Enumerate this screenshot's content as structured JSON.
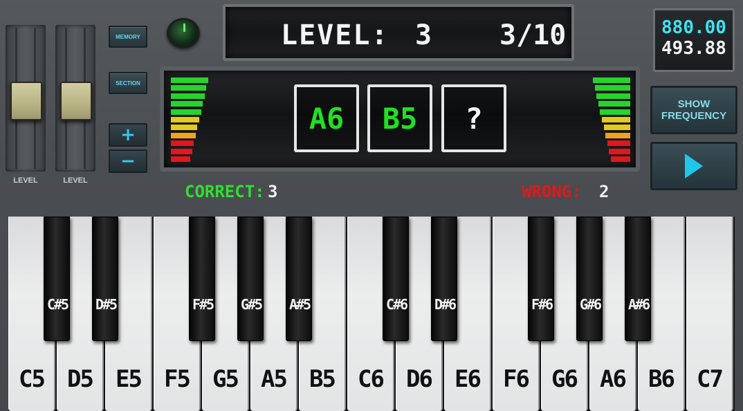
{
  "sliders": [
    {
      "label": "LEVEL"
    },
    {
      "label": "LEVEL"
    }
  ],
  "buttons": {
    "memory": "MEMORY",
    "section": "SECTION",
    "plus": "+",
    "minus": "−",
    "show_frequency": "SHOW FREQUENCY"
  },
  "level": {
    "label": "LEVEL:",
    "value": "3",
    "progress": "3/10"
  },
  "frequency": {
    "target": "880.00",
    "current": "493.88"
  },
  "notes": [
    {
      "text": "A6",
      "color": "#22e022"
    },
    {
      "text": "B5",
      "color": "#22e022"
    },
    {
      "text": "?",
      "color": "#f4f4f4"
    }
  ],
  "score": {
    "correct_label": "CORRECT:",
    "correct_value": "3",
    "wrong_label": "WRONG:",
    "wrong_value": "2",
    "correct_color": "#2fe02f",
    "wrong_color": "#e01818"
  },
  "meter_colors": {
    "green": "#27d42b",
    "yellow": "#e5c91d",
    "orange": "#f0a21c",
    "red": "#e3161b"
  },
  "keyboard": {
    "white_keys": [
      "C5",
      "D5",
      "E5",
      "F5",
      "G5",
      "A5",
      "B5",
      "C6",
      "D6",
      "E6",
      "F6",
      "G6",
      "A6",
      "B6",
      "C7"
    ],
    "black_keys": [
      "C#5",
      "D#5",
      "F#5",
      "G#5",
      "A#5",
      "C#6",
      "D#6",
      "F#6",
      "G#6",
      "A#6"
    ]
  }
}
